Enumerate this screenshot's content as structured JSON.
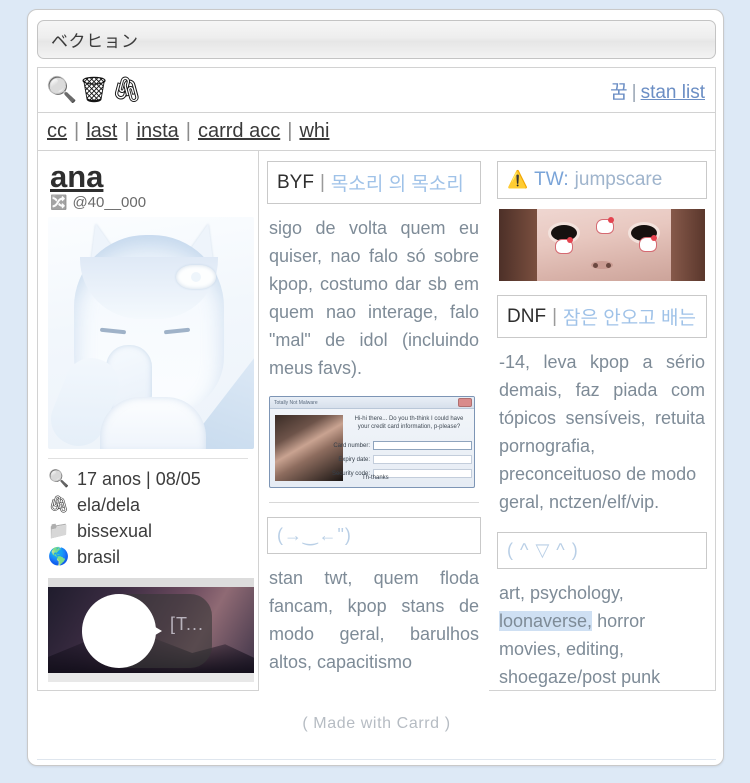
{
  "window": {
    "title": "ベクヒョン"
  },
  "toolbar": {
    "icons": [
      {
        "name": "search-icon",
        "glyph": "🔍"
      },
      {
        "name": "wastebasket-icon",
        "glyph": "🗑"
      },
      {
        "name": "paperclip-icon",
        "glyph": "🖇"
      }
    ],
    "right": {
      "dream_label": "꿈",
      "separator": "|",
      "stan_list_label": "stan list"
    }
  },
  "nav": {
    "separator": "|",
    "links": [
      {
        "label": "cc"
      },
      {
        "label": "last"
      },
      {
        "label": "insta"
      },
      {
        "label": "carrd acc"
      },
      {
        "label": "whi"
      }
    ]
  },
  "profile": {
    "name": "ana",
    "handle": "@40__000",
    "handle_icon": "shuffle-icon",
    "info": [
      {
        "icon": "magnifier-icon",
        "glyph": "🔍",
        "text": "17 anos | 08/05"
      },
      {
        "icon": "paperclip-icon",
        "glyph": "🖇",
        "text": "ela/dela"
      },
      {
        "icon": "folder-icon",
        "glyph": "📁",
        "text": "bissexual"
      },
      {
        "icon": "globe-icon",
        "glyph": "🌎",
        "text": "brasil"
      }
    ],
    "video": {
      "overlay_text": "[T...",
      "play_label": "play-button"
    }
  },
  "middle": {
    "byf": {
      "title": "BYF",
      "separator": "|",
      "subtitle": "목소리 의 목소리",
      "body": "sigo de volta quem eu quiser, nao falo só sobre kpop, costumo dar sb em quem nao interage, falo \"mal\" de idol (incluindo meus favs)."
    },
    "popup": {
      "title": "Totally Not Malware",
      "message": "Hi-hi there... Do you th-think I could have your credit card information, p-please?",
      "fields": [
        {
          "label": "Card number:",
          "value": ""
        },
        {
          "label": "Expiry date:",
          "value": ""
        },
        {
          "label": "Security code:",
          "value": ""
        }
      ],
      "button": "Th-thanks"
    },
    "dni": {
      "kaomoji": "(→‿←\")",
      "body": "stan twt, quem floda fancam, kpop stans de modo geral, barulhos altos, capacitismo"
    }
  },
  "right": {
    "tw": {
      "icon": "warning-icon",
      "glyph": "⚠️",
      "title": "TW:",
      "value": "jumpscare"
    },
    "dnf": {
      "title": "DNF",
      "separator": "|",
      "subtitle": "잠은 안오고 배는",
      "body_line1": "-14, leva kpop a sério demais, faz piada com tópicos sensíveis, retuita pornografia,",
      "body_line2": "preconceituoso de modo geral, nctzen/elf/vip."
    },
    "likes": {
      "kaomoji": "( ^ ▽ ^ )",
      "items_before": "art,                psychology,",
      "highlighted": "loonaverse,",
      "items_after": "                     horror movies,                editing, shoegaze/post punk"
    }
  },
  "footer": {
    "text": "( Made with Carrd )"
  },
  "colors": {
    "page_bg": "#dde9f6",
    "card_bg": "#ffffff",
    "link": "#6b8ec4",
    "body_text": "#7e8b97",
    "korean_accent": "#9fc2e8",
    "highlight": "#cfe0f3"
  }
}
